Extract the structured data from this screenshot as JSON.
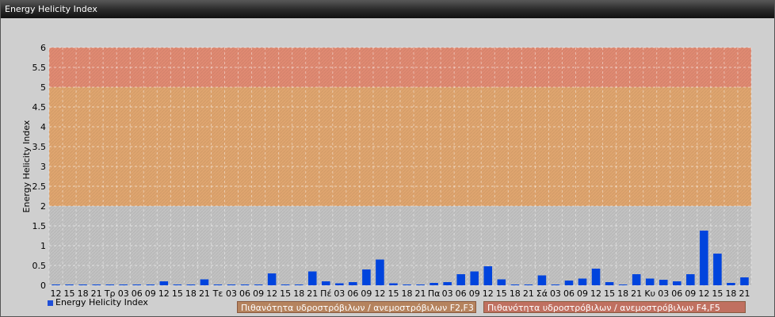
{
  "window": {
    "title": "Energy Helicity Index"
  },
  "colors": {
    "bar": "#0044dd",
    "zone_high": "#e08a72",
    "zone_mid": "#dfa56f",
    "zone_low": "#c2c2c2"
  },
  "chart_data": {
    "type": "bar",
    "ylabel": "Energy Helicity Index",
    "ylim": [
      0,
      6
    ],
    "yticks": [
      0,
      0.5,
      1,
      1.5,
      2,
      2.5,
      3,
      3.5,
      4,
      4.5,
      5,
      5.5,
      6
    ],
    "ytick_labels": [
      "0",
      "0.5",
      "1",
      "1.5",
      "2",
      "2.5",
      "3",
      "3.5",
      "4",
      "4.5",
      "5",
      "5.5",
      "6"
    ],
    "zones": [
      {
        "from": 0,
        "to": 2,
        "color": "#c2c2c2"
      },
      {
        "from": 2,
        "to": 5,
        "color": "#dfa56f"
      },
      {
        "from": 5,
        "to": 6,
        "color": "#e08a72"
      }
    ],
    "categories": [
      "12",
      "15",
      "18",
      "21",
      "Τρ",
      "03",
      "06",
      "09",
      "12",
      "15",
      "18",
      "21",
      "Τε",
      "03",
      "06",
      "09",
      "12",
      "15",
      "18",
      "21",
      "Πέ",
      "03",
      "06",
      "09",
      "12",
      "15",
      "18",
      "21",
      "Πα",
      "03",
      "06",
      "09",
      "12",
      "15",
      "18",
      "21",
      "Σά",
      "03",
      "06",
      "09",
      "12",
      "15",
      "18",
      "21",
      "Κυ",
      "03",
      "06",
      "09",
      "12",
      "15",
      "18",
      "21"
    ],
    "series": [
      {
        "name": "Energy Helicity Index",
        "values": [
          0.02,
          0.02,
          0.02,
          0.02,
          0.02,
          0.02,
          0.02,
          0.02,
          0.1,
          0.02,
          0.02,
          0.15,
          0.02,
          0.02,
          0.02,
          0.02,
          0.3,
          0.02,
          0.02,
          0.35,
          0.1,
          0.05,
          0.08,
          0.4,
          0.65,
          0.05,
          0.02,
          0.02,
          0.06,
          0.08,
          0.28,
          0.35,
          0.48,
          0.15,
          0.02,
          0.02,
          0.25,
          0.02,
          0.12,
          0.17,
          0.42,
          0.08,
          0.02,
          0.28,
          0.17,
          0.14,
          0.1,
          0.28,
          1.38,
          0.8,
          0.06,
          0.2
        ]
      }
    ],
    "legend": [
      "Energy Helicity Index",
      "Πιθανότητα υδροστρόβιλων / ανεμοστρόβιλων F2,F3",
      "Πιθανότητα υδροστρόβιλων / ανεμοστρόβιλων F4,F5"
    ],
    "grid": true
  }
}
